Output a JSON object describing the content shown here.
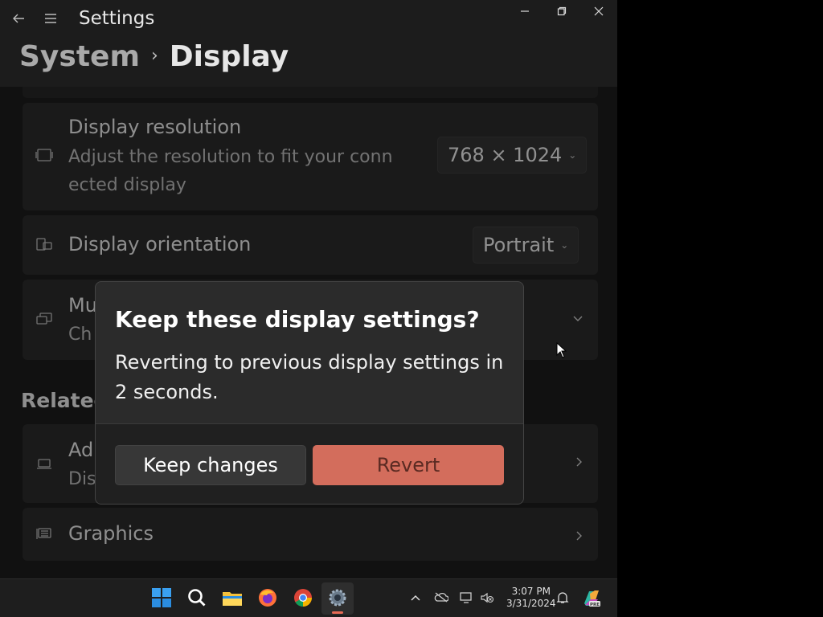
{
  "window": {
    "app_title": "Settings",
    "back_icon": "back-arrow-icon",
    "menu_icon": "hamburger-menu-icon",
    "controls": [
      "minimize",
      "maximize",
      "close"
    ]
  },
  "breadcrumb": {
    "parent": "System",
    "separator": "›",
    "current": "Display"
  },
  "settings": {
    "resolution": {
      "title": "Display resolution",
      "subtitle_line1": "Adjust the resolution to fit your conn",
      "subtitle_line2": "ected display",
      "value": "768 × 1024"
    },
    "orientation": {
      "title": "Display orientation",
      "value": "Portrait"
    },
    "multiple_displays": {
      "title_partial": "Mu",
      "subtitle_partial": "Ch"
    }
  },
  "related": {
    "heading_partial": "Related",
    "advanced": {
      "title_partial": "Ad",
      "subtitle_partial": "Dis"
    },
    "graphics": {
      "title": "Graphics"
    }
  },
  "dialog": {
    "title": "Keep these display settings?",
    "message": "Reverting to previous display settings in 2 seconds.",
    "keep_label": "Keep changes",
    "revert_label": "Revert",
    "revert_color": "#d36d5c"
  },
  "taskbar": {
    "apps": [
      "windows-start",
      "search",
      "file-explorer",
      "firefox",
      "chrome",
      "settings"
    ],
    "time": "3:07 PM",
    "date": "3/31/2024"
  }
}
